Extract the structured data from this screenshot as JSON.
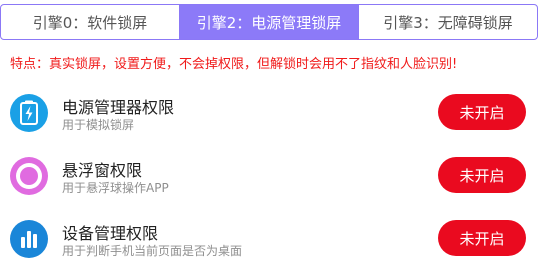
{
  "tabs": [
    {
      "label": "引擎0：软件锁屏",
      "active": false
    },
    {
      "label": "引擎2：电源管理锁屏",
      "active": true
    },
    {
      "label": "引擎3：无障碍锁屏",
      "active": false
    }
  ],
  "notice": "特点：真实锁屏，设置方便，不会掉权限，但解锁时会用不了指纹和人脸识别!",
  "permissions": [
    {
      "title": "电源管理器权限",
      "subtitle": "用于模拟锁屏",
      "button": "未开启",
      "icon": "battery-lightning-icon",
      "icon_color": "#1aa0e6"
    },
    {
      "title": "悬浮窗权限",
      "subtitle": "用于悬浮球操作APP",
      "button": "未开启",
      "icon": "floating-ball-icon",
      "icon_color": "#e06be0"
    },
    {
      "title": "设备管理权限",
      "subtitle": "用于判断手机当前页面是否为桌面",
      "button": "未开启",
      "icon": "bar-chart-icon",
      "icon_color": "#1a86d8"
    }
  ],
  "colors": {
    "accent": "#8c7af8",
    "danger": "#ea0a1f",
    "notice": "#f01a1a"
  }
}
